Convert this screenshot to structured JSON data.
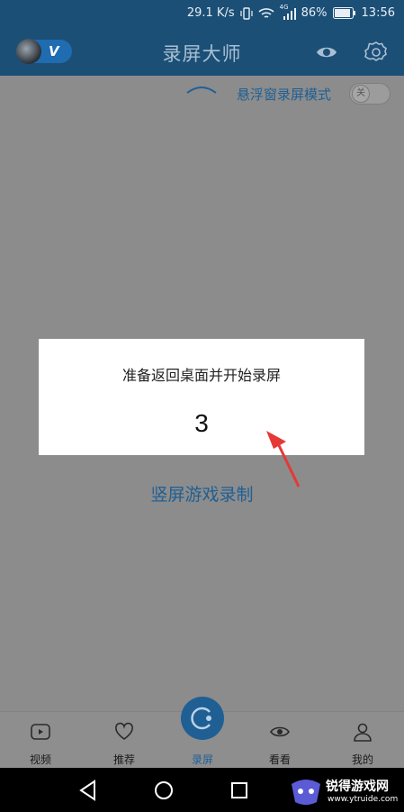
{
  "status_bar": {
    "speed": "29.1 K/s",
    "network": "4G",
    "battery": "86%",
    "time": "13:56"
  },
  "app_bar": {
    "title": "录屏大师",
    "vip_badge": "V"
  },
  "floating_mode": {
    "label": "悬浮窗录屏模式",
    "toggle_text": "关",
    "enabled": false
  },
  "main": {
    "vertical_record_label": "竖屏游戏录制"
  },
  "dialog": {
    "message": "准备返回桌面并开始录屏",
    "countdown": "3"
  },
  "tabs": [
    {
      "label": "视频",
      "icon": "video-icon",
      "active": false
    },
    {
      "label": "推荐",
      "icon": "heart-icon",
      "active": false
    },
    {
      "label": "录屏",
      "icon": "record-icon",
      "active": true
    },
    {
      "label": "看看",
      "icon": "eye-icon",
      "active": false
    },
    {
      "label": "我的",
      "icon": "user-icon",
      "active": false
    }
  ],
  "watermark": {
    "name": "锐得游戏网",
    "url": "www.ytruide.com"
  },
  "colors": {
    "app_bar": "#1b4f76",
    "accent": "#1f5f94",
    "dim_overlay": "#8c8c8c",
    "annotation_arrow": "#e53935"
  }
}
